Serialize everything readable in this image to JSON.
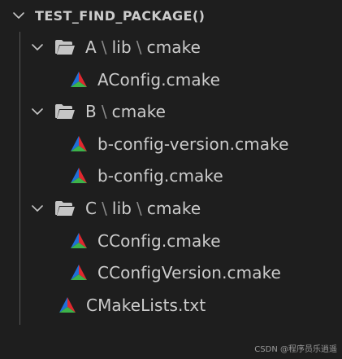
{
  "explorer": {
    "root": {
      "label": "TEST_FIND_PACKAGE()"
    },
    "folder_a": {
      "parts": [
        "A",
        "lib",
        "cmake"
      ]
    },
    "folder_a_files": [
      "AConfig.cmake"
    ],
    "folder_b": {
      "parts": [
        "B",
        "cmake"
      ]
    },
    "folder_b_files": [
      "b-config-version.cmake",
      "b-config.cmake"
    ],
    "folder_c": {
      "parts": [
        "C",
        "lib",
        "cmake"
      ]
    },
    "folder_c_files": [
      "CConfig.cmake",
      "CConfigVersion.cmake"
    ],
    "root_files": [
      "CMakeLists.txt"
    ],
    "path_separator": "\\"
  },
  "watermark": "CSDN @程序员乐逍遥",
  "icons": {
    "chevron": "chevron-down-icon",
    "folder": "folder-open-icon",
    "cmake": "cmake-file-icon"
  },
  "colors": {
    "background": "#1e1e1e",
    "text": "#cccccc",
    "folder": "#c5c5c5",
    "cmake_blue": "#1f6fd8",
    "cmake_red": "#e0282f",
    "cmake_green": "#3db34a"
  }
}
